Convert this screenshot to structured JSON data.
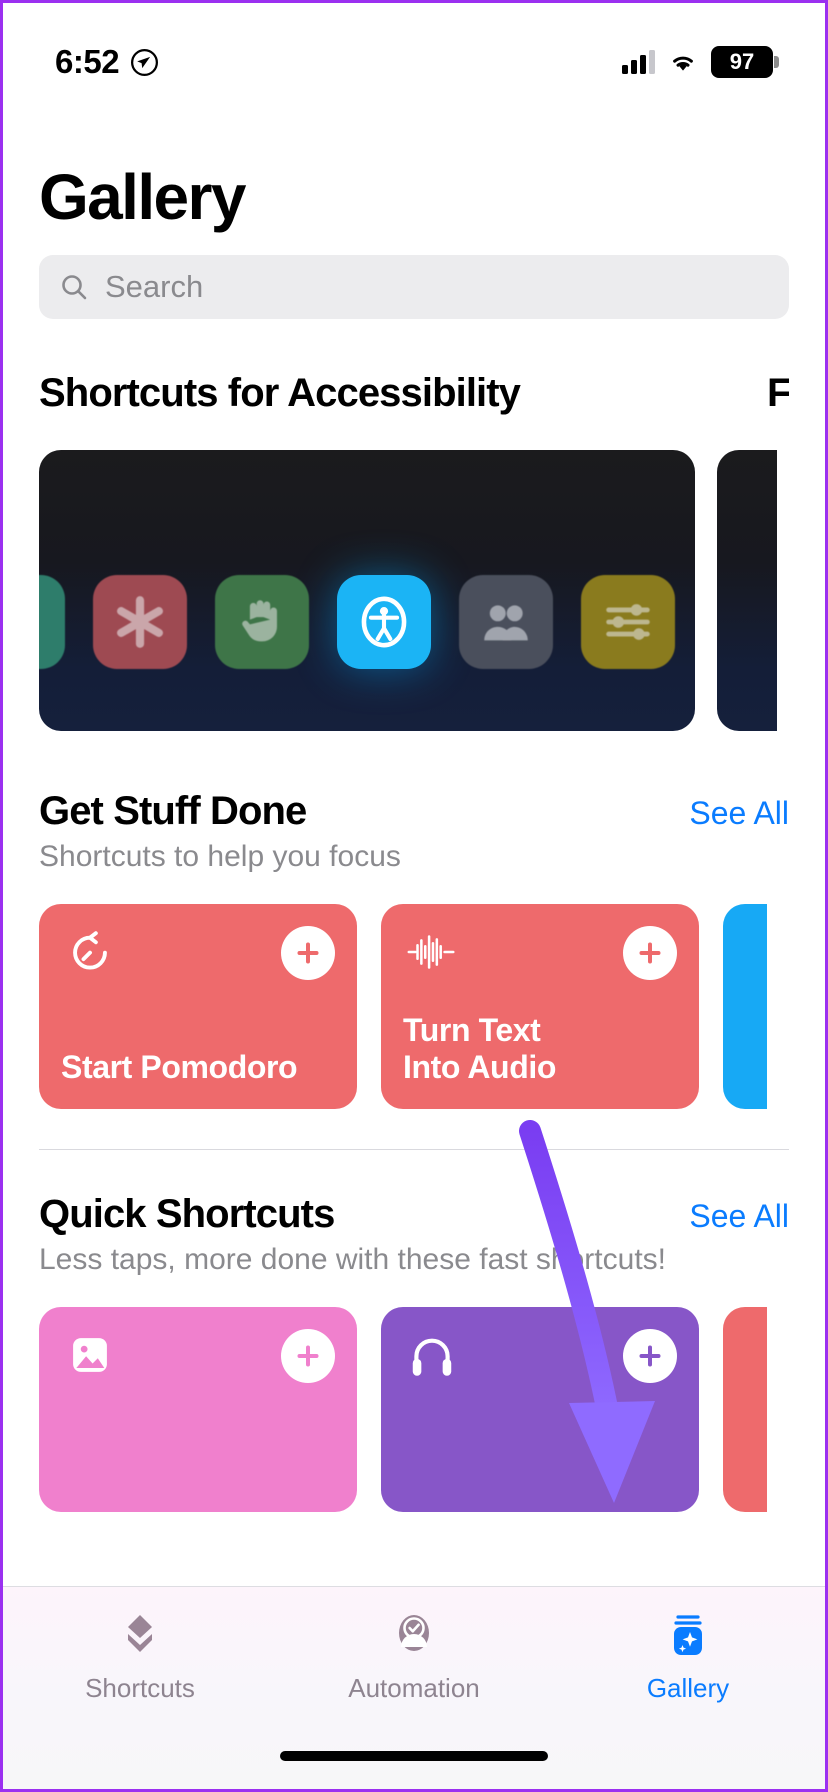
{
  "status_bar": {
    "time": "6:52",
    "location_icon": "location-arrow-icon",
    "signal_icon": "cellular-signal-icon",
    "wifi_icon": "wifi-icon",
    "battery_percent": "97"
  },
  "header": {
    "title": "Gallery"
  },
  "search": {
    "placeholder": "Search",
    "icon": "search-icon",
    "value": ""
  },
  "sections": [
    {
      "title": "Shortcuts for Accessibility",
      "subtitle": "",
      "see_all": "",
      "type": "banner"
    },
    {
      "title": "Get Stuff Done",
      "subtitle": "Shortcuts to help you focus",
      "see_all": "See All",
      "type": "cards"
    },
    {
      "title": "Quick Shortcuts",
      "subtitle": "Less taps, more done with these fast shortcuts!",
      "see_all": "See All",
      "type": "cards"
    }
  ],
  "accessibility_banner": {
    "next_title_partial": "F",
    "background": "#15203c",
    "icons": [
      {
        "name": "droplet-icon",
        "color": "#2e7d6b"
      },
      {
        "name": "asterisk-icon",
        "color": "#9e4a52"
      },
      {
        "name": "hand-raised-icon",
        "color": "#3e7548"
      },
      {
        "name": "accessibility-icon",
        "color": "#1bb4f5",
        "highlight": true
      },
      {
        "name": "people-icon",
        "color": "#4a4f5c"
      },
      {
        "name": "sliders-icon",
        "color": "#8a7b1e"
      },
      {
        "name": "sparkle-icon",
        "color": "#1f7a86"
      }
    ]
  },
  "get_stuff_done": {
    "cards": [
      {
        "label": "Start Pomodoro",
        "icon": "timer-icon",
        "color": "#ee6a6c",
        "add_label": "+"
      },
      {
        "label": "Turn Text\nInto Audio",
        "icon": "waveform-icon",
        "color": "#ee6a6c",
        "add_label": "+"
      },
      {
        "label": "",
        "icon": "",
        "color": "#17a9f5",
        "add_label": ""
      }
    ]
  },
  "quick_shortcuts": {
    "cards": [
      {
        "label": "",
        "icon": "photo-icon",
        "color": "#f080cd",
        "add_label": "+"
      },
      {
        "label": "",
        "icon": "headphones-icon",
        "color": "#8756c8",
        "add_label": "+"
      },
      {
        "label": "",
        "icon": "",
        "color": "#ee6a6c",
        "add_label": ""
      }
    ]
  },
  "tab_bar": {
    "items": [
      {
        "label": "Shortcuts",
        "icon": "shortcuts-stack-icon",
        "active": false
      },
      {
        "label": "Automation",
        "icon": "automation-check-icon",
        "active": false
      },
      {
        "label": "Gallery",
        "icon": "gallery-sparkle-icon",
        "active": true
      }
    ],
    "active_color": "#0a7cff",
    "inactive_color": "#8e8490"
  },
  "annotation": {
    "type": "arrow",
    "color": "#7a52f4",
    "points_to": "Gallery"
  }
}
